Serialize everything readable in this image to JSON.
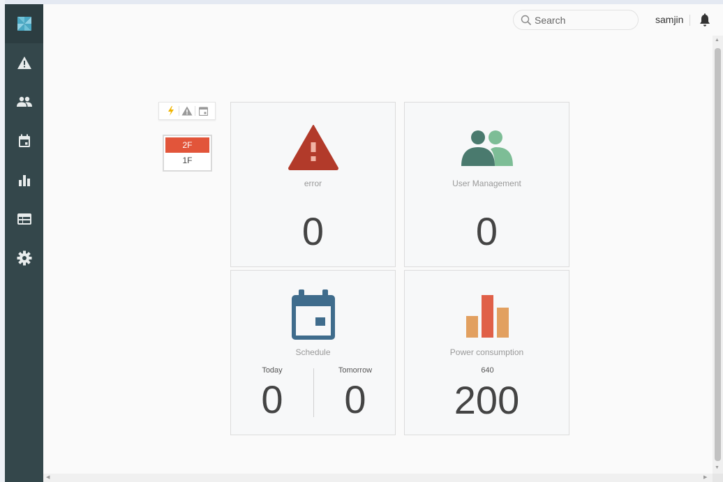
{
  "header": {
    "search_placeholder": "Search",
    "username": "samjin"
  },
  "sidebar": {
    "logo": "pinwheel-logo",
    "items": [
      {
        "name": "alert",
        "icon": "warning-icon"
      },
      {
        "name": "users",
        "icon": "people-icon"
      },
      {
        "name": "schedule",
        "icon": "calendar-icon"
      },
      {
        "name": "statistics",
        "icon": "bar-chart-icon"
      },
      {
        "name": "dashboard",
        "icon": "panel-icon"
      },
      {
        "name": "settings",
        "icon": "gear-icon"
      }
    ]
  },
  "filters": [
    {
      "icon": "lightning-icon",
      "color": "#f0b400"
    },
    {
      "icon": "warning-icon",
      "color": "#9a9a9a"
    },
    {
      "icon": "calendar-icon",
      "color": "#9a9a9a"
    }
  ],
  "floors": [
    {
      "label": "2F",
      "active": true
    },
    {
      "label": "1F",
      "active": false
    }
  ],
  "cards": {
    "error": {
      "label": "error",
      "value": "0",
      "color": "#b23a2a"
    },
    "users": {
      "label": "User Management",
      "value": "0",
      "color_dark": "#4a7a6e",
      "color_light": "#7dbd96"
    },
    "schedule": {
      "label": "Schedule",
      "today_label": "Today",
      "today_value": "0",
      "tomorrow_label": "Tomorrow",
      "tomorrow_value": "0",
      "color": "#3f6c8c"
    },
    "power": {
      "label": "Power consumption",
      "sub": "640",
      "value": "200",
      "colors": [
        "#e2a060",
        "#e06048",
        "#e2a060"
      ]
    }
  },
  "colors": {
    "sidebar": "#34474b",
    "accent": "#e2553a"
  }
}
